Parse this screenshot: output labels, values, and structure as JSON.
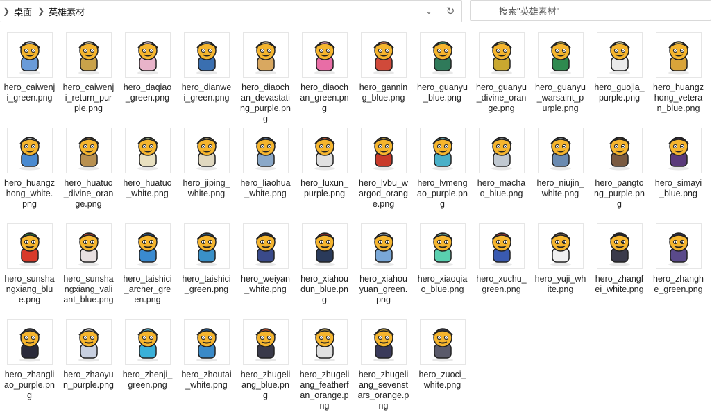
{
  "address": {
    "breadcrumbs": [
      "桌面",
      "英雄素材"
    ]
  },
  "search": {
    "placeholder": "搜索\"英雄素材\""
  },
  "files": [
    {
      "name": "hero_caiwenji_green.png",
      "color": "#6a9bd8",
      "hat": "#cfd8e6"
    },
    {
      "name": "hero_caiwenji_return_purple.png",
      "color": "#c9a24a",
      "hat": "#e8d7a0"
    },
    {
      "name": "hero_daqiao_green.png",
      "color": "#e8b3c9",
      "hat": "#f3d3de"
    },
    {
      "name": "hero_dianwei_green.png",
      "color": "#3a6fb0",
      "hat": "#7a8aa5"
    },
    {
      "name": "hero_diaochan_devastating_purple.png",
      "color": "#d9a860",
      "hat": "#e8c98f"
    },
    {
      "name": "hero_diaochan_green.png",
      "color": "#e86da6",
      "hat": "#f59cc3"
    },
    {
      "name": "hero_ganning_blue.png",
      "color": "#d04a3a",
      "hat": "#e07a50"
    },
    {
      "name": "hero_guanyu_blue.png",
      "color": "#2f7a5a",
      "hat": "#3f9a6f"
    },
    {
      "name": "hero_guanyu_divine_orange.png",
      "color": "#c9a830",
      "hat": "#e5cf5a"
    },
    {
      "name": "hero_guanyu_warsaint_purple.png",
      "color": "#2e8a4f",
      "hat": "#c9a830"
    },
    {
      "name": "hero_guojia_purple.png",
      "color": "#eaeaea",
      "hat": "#f5e7a0"
    },
    {
      "name": "hero_huangzhong_veteran_blue.png",
      "color": "#d9a43a",
      "hat": "#f0d070"
    },
    {
      "name": "hero_huangzhong_white.png",
      "color": "#4a8ad0",
      "hat": "#e8f0f8"
    },
    {
      "name": "hero_huatuo_divine_orange.png",
      "color": "#b89050",
      "hat": "#8a6a3a"
    },
    {
      "name": "hero_huatuo_white.png",
      "color": "#e8e0c0",
      "hat": "#b0c890"
    },
    {
      "name": "hero_jiping_white.png",
      "color": "#e0d8c0",
      "hat": "#c0a870"
    },
    {
      "name": "hero_liaohua_white.png",
      "color": "#8aa8c8",
      "hat": "#5a7aa8"
    },
    {
      "name": "hero_luxun_purple.png",
      "color": "#e0e0e0",
      "hat": "#e85a2a"
    },
    {
      "name": "hero_lvbu_wargod_orange.png",
      "color": "#c83a2a",
      "hat": "#d9a830"
    },
    {
      "name": "hero_lvmengao_purple.png",
      "color": "#4ab0c8",
      "hat": "#70c8d8"
    },
    {
      "name": "hero_machao_blue.png",
      "color": "#c0c8d0",
      "hat": "#8a949e"
    },
    {
      "name": "hero_niujin_white.png",
      "color": "#6a8ab0",
      "hat": "#8a9aa8"
    },
    {
      "name": "hero_pangtong_purple.png",
      "color": "#7a5a40",
      "hat": "#5a4030"
    },
    {
      "name": "hero_simayi_blue.png",
      "color": "#5a3a7a",
      "hat": "#3a2a4a"
    },
    {
      "name": "hero_sunshangxiang_blue.png",
      "color": "#d83a2a",
      "hat": "#30a040"
    },
    {
      "name": "hero_sunshangxiang_valiant_blue.png",
      "color": "#e8e0e0",
      "hat": "#e04a3a"
    },
    {
      "name": "hero_taishici_archer_green.png",
      "color": "#3a8ad0",
      "hat": "#2a6ab0"
    },
    {
      "name": "hero_taishici_green.png",
      "color": "#3a90c8",
      "hat": "#2a70a8"
    },
    {
      "name": "hero_weiyan_white.png",
      "color": "#3a4a8a",
      "hat": "#2a3a6a"
    },
    {
      "name": "hero_xiahoudun_blue.png",
      "color": "#2a3a5a",
      "hat": "#c83030"
    },
    {
      "name": "hero_xiahouyuan_green.png",
      "color": "#7aa8d8",
      "hat": "#b0c8e0"
    },
    {
      "name": "hero_xiaoqiao_blue.png",
      "color": "#5ad0b0",
      "hat": "#80e0c8"
    },
    {
      "name": "hero_xuchu_green.png",
      "color": "#3a5ab0",
      "hat": "#d83a3a"
    },
    {
      "name": "hero_yuji_white.png",
      "color": "#f0f0f0",
      "hat": "#8a7060"
    },
    {
      "name": "hero_zhangfei_white.png",
      "color": "#3a3a4a",
      "hat": "#2a2a3a"
    },
    {
      "name": "hero_zhanghe_green.png",
      "color": "#5a4a8a",
      "hat": "#3a3a6a"
    },
    {
      "name": "hero_zhangliao_purple.png",
      "color": "#2a2a3a",
      "hat": "#4a4a5a"
    },
    {
      "name": "hero_zhaoyun_purple.png",
      "color": "#c8d0e0",
      "hat": "#e8e8f0"
    },
    {
      "name": "hero_zhenji_green.png",
      "color": "#3ab0d8",
      "hat": "#60c8e8"
    },
    {
      "name": "hero_zhoutai_white.png",
      "color": "#3a8ac8",
      "hat": "#2a6aa8"
    },
    {
      "name": "hero_zhugeliang_blue.png",
      "color": "#3a3a4a",
      "hat": "#e85a2a"
    },
    {
      "name": "hero_zhugeliang_featherfan_orange.png",
      "color": "#e0e0e0",
      "hat": "#c8a850"
    },
    {
      "name": "hero_zhugeliang_sevenstars_orange.png",
      "color": "#3a3a5a",
      "hat": "#d9b040"
    },
    {
      "name": "hero_zuoci_white.png",
      "color": "#5a5a6a",
      "hat": "#3a3a4a"
    }
  ]
}
